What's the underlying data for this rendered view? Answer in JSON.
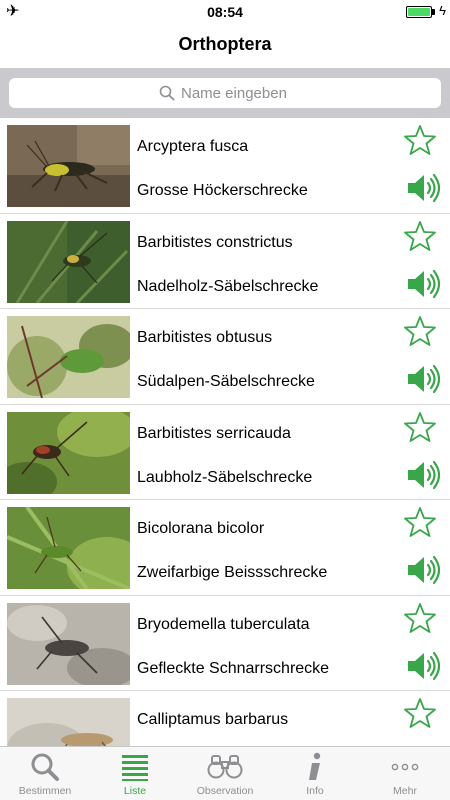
{
  "status_bar": {
    "time": "08:54",
    "battery_level": 1.0,
    "battery_color": "#4cd964"
  },
  "nav": {
    "title": "Orthoptera"
  },
  "search": {
    "placeholder": "Name eingeben",
    "value": ""
  },
  "accent_color": "#3aa64a",
  "species": [
    {
      "latin": "Arcyptera fusca",
      "common": "Grosse Höckerschrecke",
      "has_audio": true
    },
    {
      "latin": "Barbitistes constrictus",
      "common": "Nadelholz-Säbelschrecke",
      "has_audio": true
    },
    {
      "latin": "Barbitistes obtusus",
      "common": "Südalpen-Säbelschrecke",
      "has_audio": true
    },
    {
      "latin": "Barbitistes serricauda",
      "common": "Laubholz-Säbelschrecke",
      "has_audio": true
    },
    {
      "latin": "Bicolorana bicolor",
      "common": "Zweifarbige Beissschrecke",
      "has_audio": true
    },
    {
      "latin": "Bryodemella tuberculata",
      "common": "Gefleckte Schnarrschrecke",
      "has_audio": true
    },
    {
      "latin": "Calliptamus barbarus",
      "common": "",
      "has_audio": false
    }
  ],
  "tabs": [
    {
      "label": "Bestimmen",
      "icon": "search-icon",
      "active": false
    },
    {
      "label": "Liste",
      "icon": "list-icon",
      "active": true
    },
    {
      "label": "Observation",
      "icon": "binoculars-icon",
      "active": false
    },
    {
      "label": "Info",
      "icon": "info-icon",
      "active": false
    },
    {
      "label": "Mehr",
      "icon": "more-icon",
      "active": false
    }
  ]
}
